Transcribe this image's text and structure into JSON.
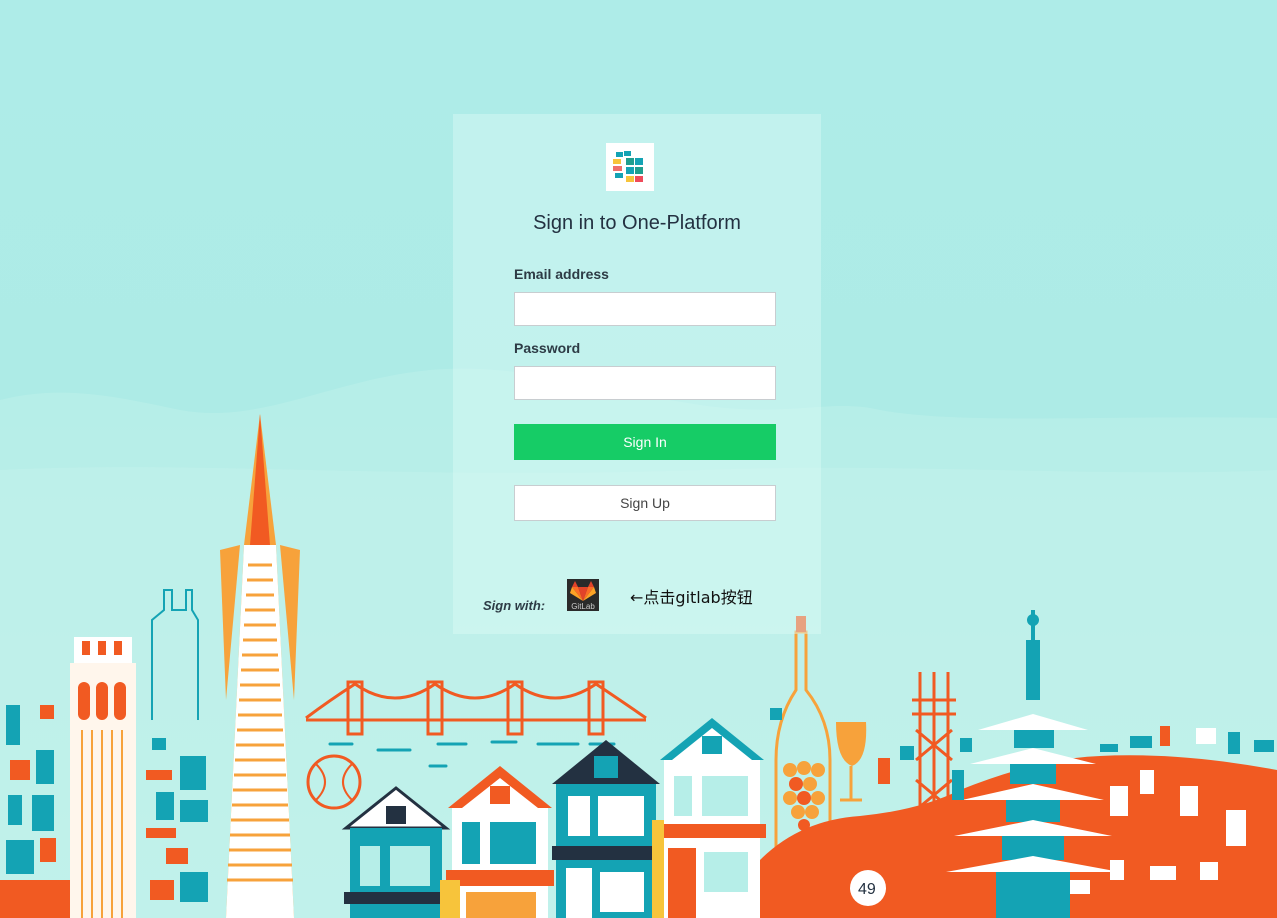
{
  "app": {
    "title": "Sign in to One-Platform"
  },
  "form": {
    "email_label": "Email address",
    "email_value": "",
    "password_label": "Password",
    "password_value": "",
    "signin_label": "Sign In",
    "signup_label": "Sign Up"
  },
  "sso": {
    "sign_with_label": "Sign with:",
    "gitlab_icon_text": "GitLab",
    "hint": "←点击gitlab按钮"
  },
  "colors": {
    "background": "#aeece8",
    "primary_button": "#16cc66",
    "accent_orange": "#f15a22",
    "accent_teal": "#14a3b4"
  },
  "icons": {
    "logo": "one-platform-logo-icon",
    "gitlab": "gitlab-icon"
  }
}
